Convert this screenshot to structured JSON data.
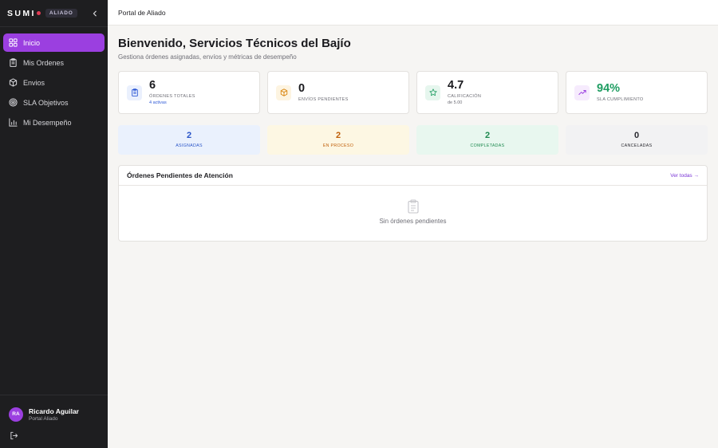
{
  "sidebar": {
    "brand": "SUMI",
    "badge": "ALIADO",
    "items": [
      {
        "label": "Inicio",
        "icon": "dashboard-icon",
        "active": true
      },
      {
        "label": "Mis Ordenes",
        "icon": "clipboard-icon",
        "active": false
      },
      {
        "label": "Envios",
        "icon": "package-icon",
        "active": false
      },
      {
        "label": "SLA Objetivos",
        "icon": "target-icon",
        "active": false
      },
      {
        "label": "Mi Desempeño",
        "icon": "bar-chart-icon",
        "active": false
      }
    ],
    "user": {
      "initials": "RA",
      "name": "Ricardo Aguilar",
      "role": "Portal Aliado"
    }
  },
  "topbar": {
    "title": "Portal de Aliado"
  },
  "main": {
    "title": "Bienvenido, Servicios Técnicos del Bajío",
    "subtitle": "Gestiona órdenes asignadas, envíos y métricas de desempeño",
    "stats": [
      {
        "value": "6",
        "label": "ÓRDENES TOTALES",
        "extra": "4 activas",
        "icon": "clipboard-icon"
      },
      {
        "value": "0",
        "label": "ENVÍOS PENDIENTES",
        "extra": "",
        "icon": "package-icon"
      },
      {
        "value": "4.7",
        "label": "CALIFICACIÓN",
        "extra": "de 5.00",
        "icon": "star-icon"
      },
      {
        "value": "94%",
        "label": "SLA CUMPLIMIENTO",
        "extra": "",
        "icon": "trending-up-icon"
      }
    ],
    "status": [
      {
        "value": "2",
        "label": "ASIGNADAS"
      },
      {
        "value": "2",
        "label": "EN PROCESO"
      },
      {
        "value": "2",
        "label": "COMPLETADAS"
      },
      {
        "value": "0",
        "label": "CANCELADAS"
      }
    ],
    "pending": {
      "title": "Órdenes Pendientes de Atención",
      "link": "Ver todas →",
      "empty": "Sin órdenes pendientes"
    }
  },
  "colors": {
    "accent": "#9b3fe0",
    "sidebar_bg": "#1e1e20",
    "success": "#1f9d62"
  }
}
